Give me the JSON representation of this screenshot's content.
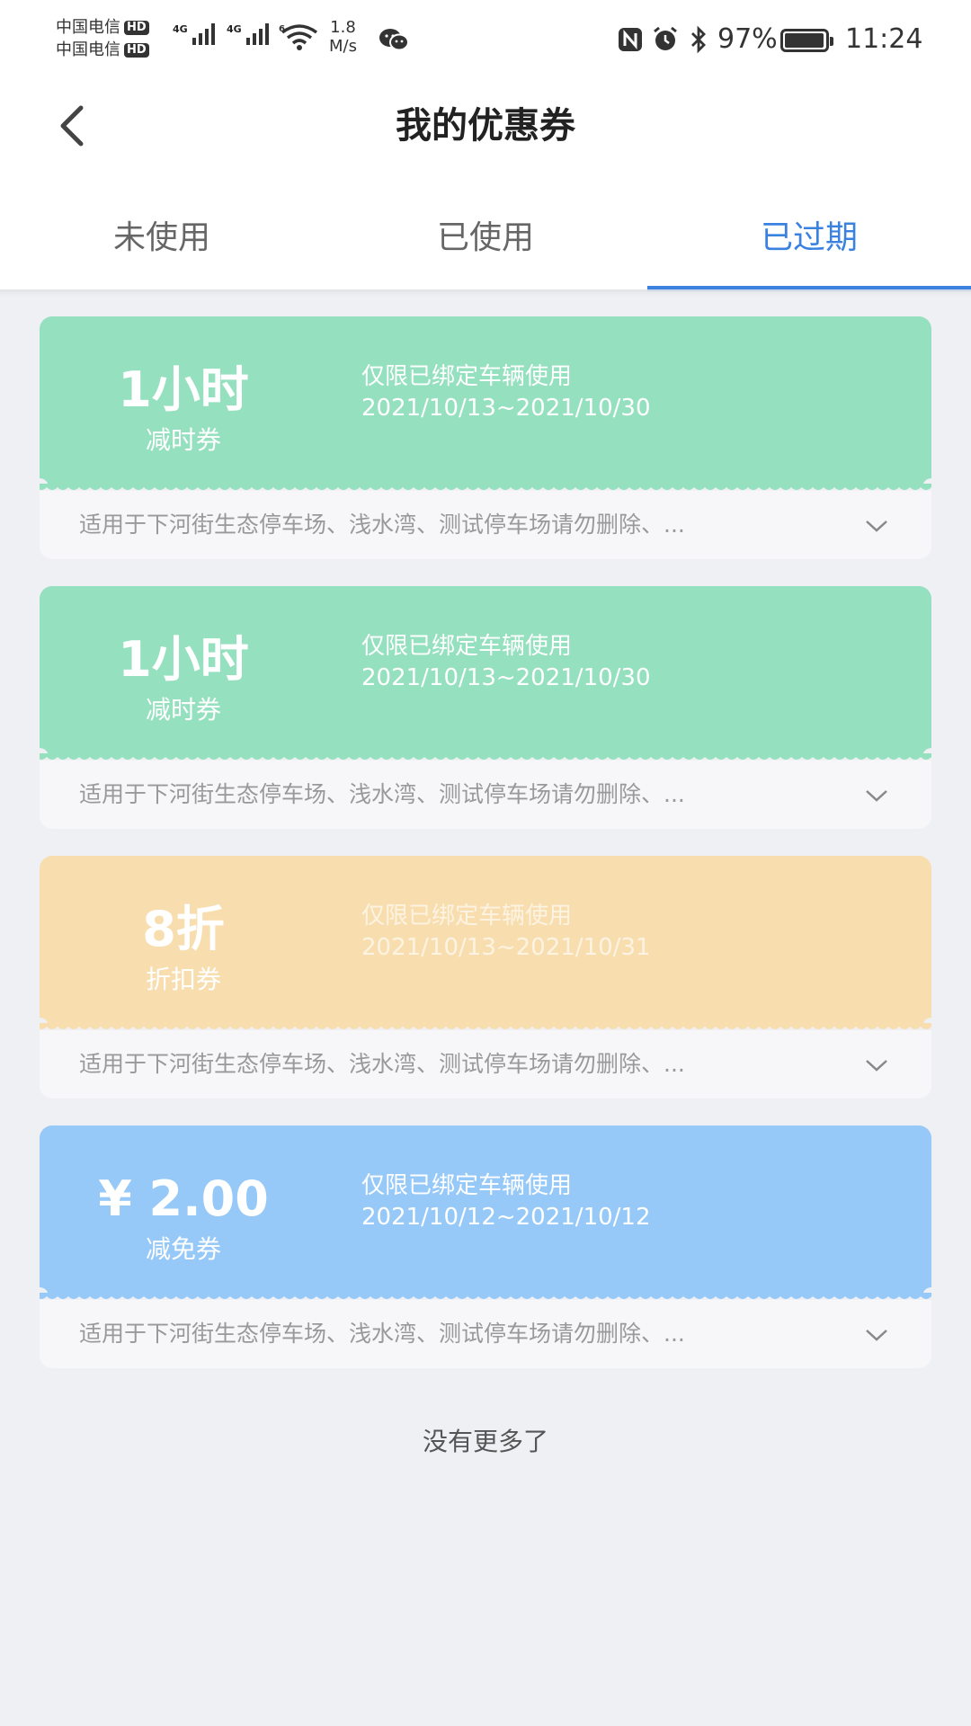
{
  "status_bar": {
    "carrier_1": "中国电信",
    "carrier_2": "中国电信",
    "hd_badge": "HD",
    "net_1": "4G",
    "net_2": "4G",
    "wifi_label": "6",
    "speed_value": "1.8",
    "speed_unit": "M/s",
    "battery_percent": "97%",
    "battery_level": 0.97,
    "time": "11:24",
    "icons": [
      "signal-icon",
      "wifi-icon",
      "wechat-icon",
      "nfc-icon",
      "alarm-icon",
      "bluetooth-icon",
      "battery-icon"
    ]
  },
  "header": {
    "title": "我的优惠券",
    "back_icon": "chevron-left-icon"
  },
  "tabs": [
    {
      "label": "未使用",
      "active": false
    },
    {
      "label": "已使用",
      "active": false
    },
    {
      "label": "已过期",
      "active": true
    }
  ],
  "colors": {
    "accent": "#3b82e0",
    "green_card": "#95e0bf",
    "orange_card": "#f8deaf",
    "blue_card": "#96c9f7"
  },
  "coupons": [
    {
      "value": "1小时",
      "type": "减时券",
      "limit": "仅限已绑定车辆使用",
      "date": "2021/10/13~2021/10/30",
      "desc": "适用于下河街生态停车场、浅水湾、测试停车场请勿删除、...",
      "color": "green"
    },
    {
      "value": "1小时",
      "type": "减时券",
      "limit": "仅限已绑定车辆使用",
      "date": "2021/10/13~2021/10/30",
      "desc": "适用于下河街生态停车场、浅水湾、测试停车场请勿删除、...",
      "color": "green"
    },
    {
      "value": "8折",
      "type": "折扣券",
      "limit": "仅限已绑定车辆使用",
      "date": "2021/10/13~2021/10/31",
      "desc": "适用于下河街生态停车场、浅水湾、测试停车场请勿删除、...",
      "color": "orange"
    },
    {
      "value": "¥ 2.00",
      "type": "减免券",
      "limit": "仅限已绑定车辆使用",
      "date": "2021/10/12~2021/10/12",
      "desc": "适用于下河街生态停车场、浅水湾、测试停车场请勿删除、...",
      "color": "blue"
    }
  ],
  "footer": {
    "no_more": "没有更多了"
  }
}
